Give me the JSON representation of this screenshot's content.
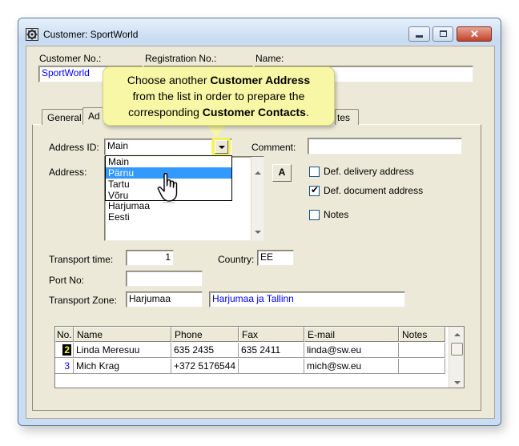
{
  "window": {
    "title": "Customer: SportWorld"
  },
  "header": {
    "customer_no_label": "Customer No.:",
    "registration_no_label": "Registration No.:",
    "name_label": "Name:",
    "customer_no_value": "SportWorld"
  },
  "tabs": [
    {
      "label": "General"
    },
    {
      "label": "Ad"
    },
    {
      "label": "tes"
    }
  ],
  "address": {
    "address_id_label": "Address ID:",
    "address_id_value": "Main",
    "comment_label": "Comment:",
    "address_label": "Address:",
    "address_lines": [
      "Harjumaa",
      "Eesti"
    ],
    "font_button_label": "A",
    "dropdown_items": [
      "Main",
      "Pärnu",
      "Tartu",
      "Võru"
    ],
    "dropdown_selected": 1
  },
  "checkboxes": {
    "def_delivery": {
      "label": "Def. delivery address",
      "checked": false
    },
    "def_document": {
      "label": "Def. document address",
      "checked": true
    },
    "notes": {
      "label": "Notes",
      "checked": false
    }
  },
  "transport": {
    "transport_time_label": "Transport time:",
    "transport_time_value": "1",
    "country_label": "Country:",
    "country_value": "EE",
    "port_no_label": "Port No:",
    "port_no_value": "",
    "zone_label": "Transport Zone:",
    "zone_code": "Harjumaa",
    "zone_name": "Harjumaa ja Tallinn"
  },
  "contacts": {
    "columns": [
      "No.",
      "Name",
      "Phone",
      "Fax",
      "E-mail",
      "Notes"
    ],
    "rows": [
      {
        "no": "2",
        "name": "Linda Meresuu",
        "phone": "635 2435",
        "fax": "635 2411",
        "email": "linda@sw.eu",
        "notes": ""
      },
      {
        "no": "3",
        "name": "Mich Krag",
        "phone": "+372 5176544",
        "fax": "",
        "email": "mich@sw.eu",
        "notes": ""
      }
    ]
  },
  "tooltip": {
    "line1_a": "Choose another ",
    "line1_b": "Customer Address",
    "line2": "from the list in order to prepare the",
    "line3_a": "corresponding ",
    "line3_b": "Customer Contacts",
    "line3_c": "."
  }
}
